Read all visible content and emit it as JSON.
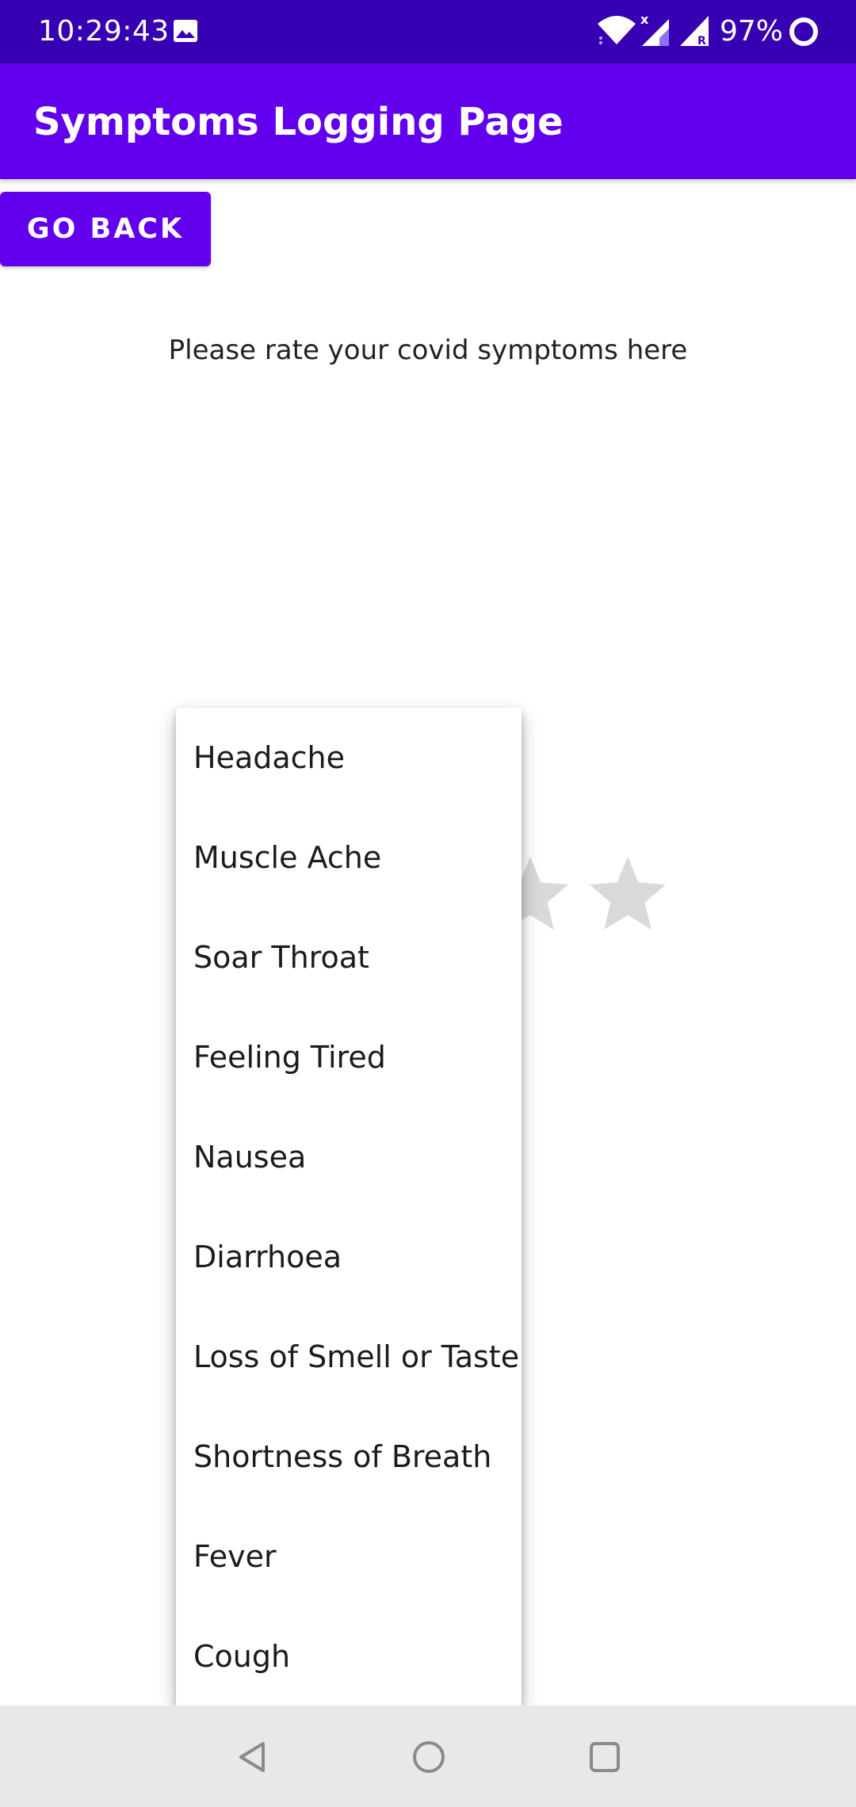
{
  "status_bar": {
    "time": "10:29:43",
    "battery": "97%",
    "icons": [
      "gallery-icon",
      "wifi-icon",
      "cell-signal-icon",
      "cell-signal-roaming-icon",
      "battery-icon"
    ]
  },
  "app_bar": {
    "title": "Symptoms Logging Page",
    "color": "#6200ee"
  },
  "go_back_button": {
    "label": "GO BACK"
  },
  "prompt": {
    "text": "Please rate your covid symptoms here"
  },
  "rating": {
    "stars_visible": 2,
    "star_color": "#d9d9d9",
    "icon": "star-icon"
  },
  "dropdown": {
    "items": [
      "Headache",
      "Muscle Ache",
      "Soar Throat",
      "Feeling Tired",
      "Nausea",
      "Diarrhoea",
      "Loss of Smell or Taste",
      "Shortness of Breath",
      "Fever",
      "Cough"
    ]
  },
  "nav_bar": {
    "icons": [
      "back-icon",
      "home-icon",
      "recents-icon"
    ]
  },
  "colors": {
    "status_bar": "#3700b3",
    "accent": "#6200ee"
  }
}
